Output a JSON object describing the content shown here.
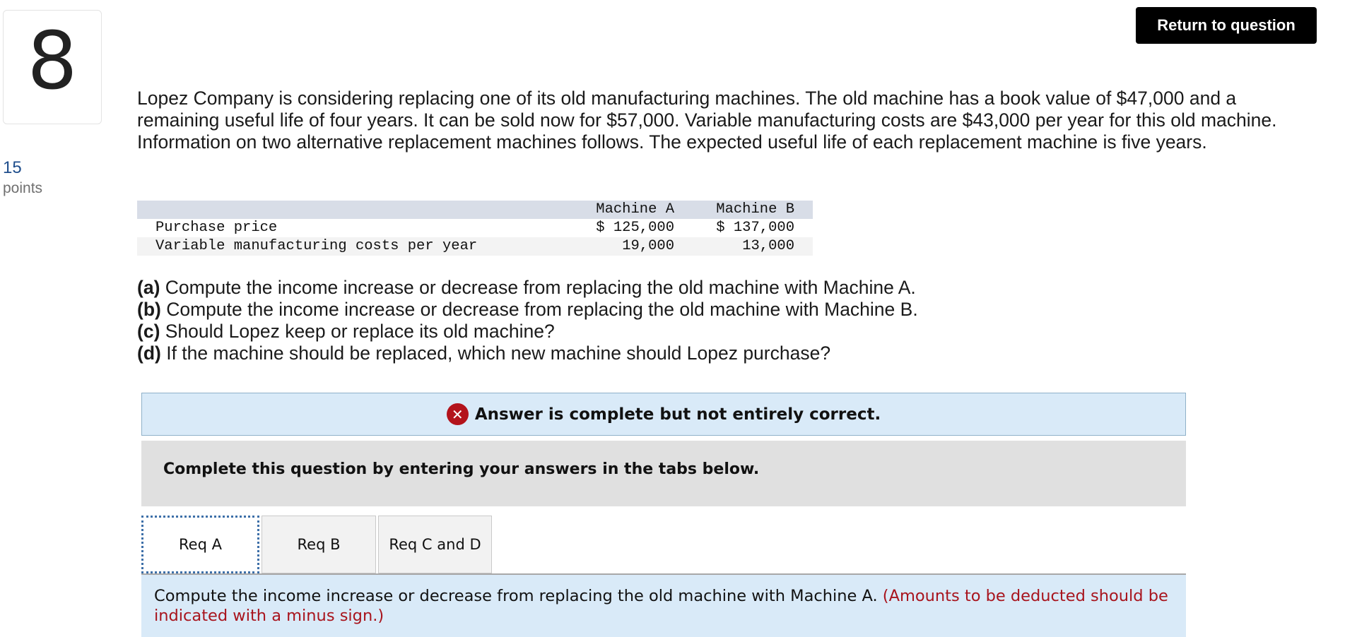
{
  "question": {
    "number": "8",
    "points_value": "15",
    "points_label": "points"
  },
  "header": {
    "return_label": "Return to question"
  },
  "problem_text": "Lopez Company is considering replacing one of its old manufacturing machines. The old machine has a book value of $47,000 and a remaining useful life of four years. It can be sold now for $57,000. Variable manufacturing costs are $43,000 per year for this old machine. Information on two alternative replacement machines follows. The expected useful life of each replacement machine is five years.",
  "machine_table": {
    "columns": [
      "Machine A",
      "Machine B"
    ],
    "rows": [
      {
        "label": "Purchase price",
        "a": "$ 125,000",
        "b": "$ 137,000"
      },
      {
        "label": "Variable manufacturing costs per year",
        "a": "19,000",
        "b": "13,000"
      }
    ]
  },
  "requirements": [
    {
      "tag": "(a)",
      "text": " Compute the income increase or decrease from replacing the old machine with Machine A."
    },
    {
      "tag": "(b)",
      "text": " Compute the income increase or decrease from replacing the old machine with Machine B."
    },
    {
      "tag": "(c)",
      "text": " Should Lopez keep or replace its old machine?"
    },
    {
      "tag": "(d)",
      "text": " If the machine should be replaced, which new machine should Lopez purchase?"
    }
  ],
  "banner": {
    "icon": "x-circle-icon",
    "text": "Answer is complete but not entirely correct."
  },
  "instruction": "Complete this question by entering your answers in the tabs below.",
  "tabs": [
    {
      "label": "Req A",
      "active": true
    },
    {
      "label": "Req B",
      "active": false
    },
    {
      "label": "Req C and D",
      "active": false
    }
  ],
  "panel": {
    "text": "Compute the income increase or decrease from replacing the old machine with Machine A.",
    "note": "(Amounts to be deducted should be indicated with a minus sign.)"
  },
  "colors": {
    "error_red": "#b3131b",
    "banner_bg": "#d9eaf8",
    "points_blue": "#1f4e8c"
  }
}
